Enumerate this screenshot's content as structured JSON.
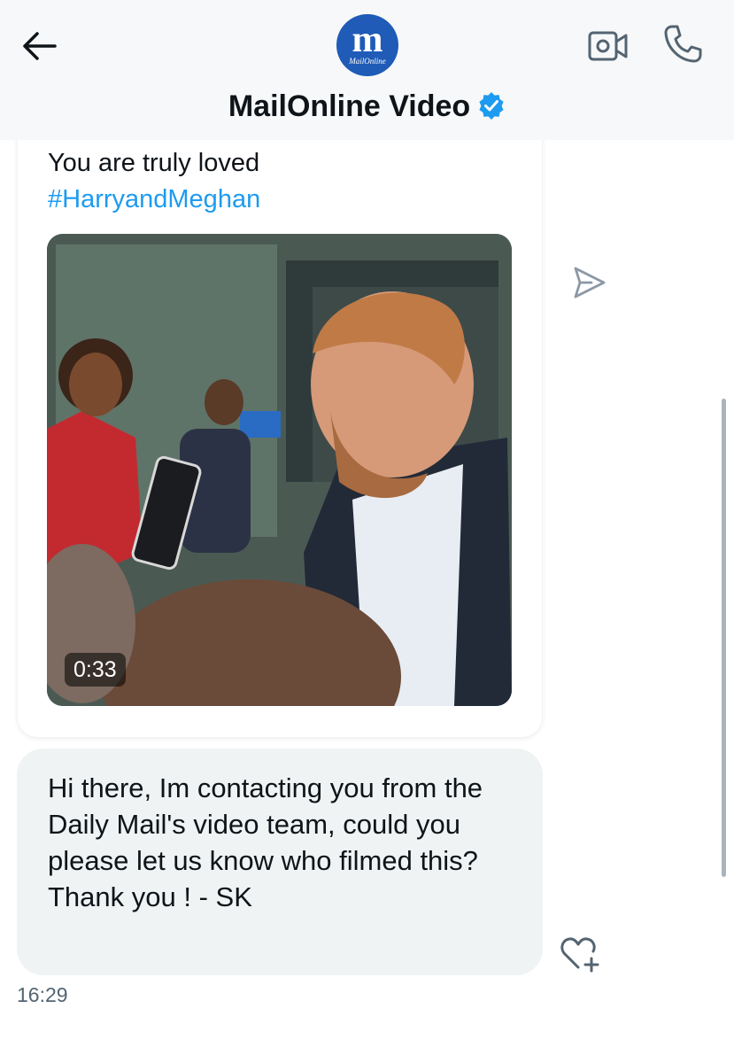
{
  "header": {
    "title": "MailOnline Video",
    "avatar_monogram": "m",
    "avatar_text": "MailOnline",
    "back_icon": "back-arrow-icon",
    "video_call_icon": "video-camera-icon",
    "phone_icon": "phone-icon",
    "verified_icon": "verified-badge-icon",
    "verified_color": "#1d9bf0"
  },
  "shared_post": {
    "text": "You are truly loved",
    "hashtag": "#HarryandMeghan",
    "hashtag_color": "#1d9bf0",
    "video_duration": "0:33"
  },
  "message": {
    "text": "Hi there, Im contacting you from the Daily Mail's video team, could you please let us know who filmed this? Thank you ! - SK",
    "timestamp": "16:29"
  },
  "icons": {
    "share": "send-icon",
    "react": "heart-plus-icon"
  }
}
